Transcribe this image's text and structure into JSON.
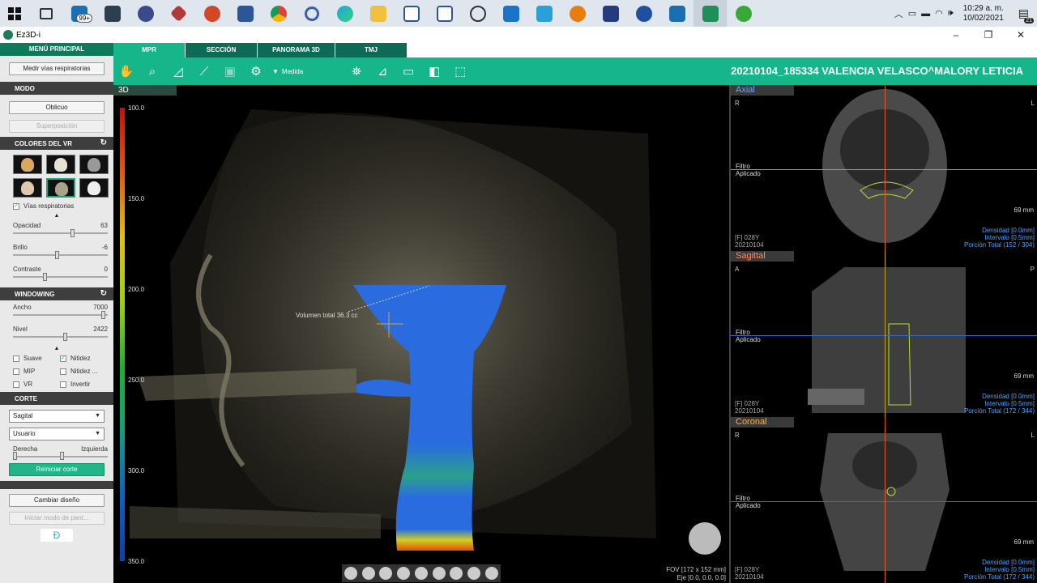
{
  "taskbar": {
    "badge": "99+",
    "time": "10:29 a. m.",
    "date": "10/02/2021",
    "notifications": "21"
  },
  "window": {
    "title": "Ez3D-i"
  },
  "left": {
    "menu_head": "MENÚ PRINCIPAL",
    "airway_button": "Medir vías respiratorias",
    "modo": "MODO",
    "oblicuo": "Oblicuo",
    "superposicion": "Superposición",
    "colores": "COLORES DEL VR",
    "vias_chk": "Vías respiratorias",
    "opacidad_lbl": "Opacidad",
    "opacidad_val": "63",
    "brillo_lbl": "Brillo",
    "brillo_val": "-6",
    "contraste_lbl": "Contraste",
    "contraste_val": "0",
    "windowing": "WINDOWING",
    "ancho_lbl": "Ancho",
    "ancho_val": "7000",
    "nivel_lbl": "Nivel",
    "nivel_val": "2422",
    "suave": "Suave",
    "nitidez": "Nitidez",
    "mip": "MIP",
    "nitidez2": "Nitidez ...",
    "vr": "VR",
    "invertir": "Invertir",
    "corte": "CORTE",
    "sagital": "Sagital",
    "usuario": "Usuario",
    "derecha": "Derecha",
    "izquierda": "Izquierda",
    "reiniciar": "Reiniciar corte",
    "cambiar": "Cambiar diseño",
    "iniciar": "Iniciar modo de pant..."
  },
  "tabs": [
    "MPR",
    "SECCIÓN",
    "PANORAMA 3D",
    "TMJ"
  ],
  "toolbar": {
    "medida": "Medida",
    "patient": "20210104_185334 VALENCIA VELASCO^MALORY LETICIA"
  },
  "view3d": {
    "label": "3D",
    "ticks": [
      "100.0",
      "150.0",
      "200.0",
      "250.0",
      "300.0",
      "350.0"
    ],
    "volume": "Volumen total 36.3 cc",
    "fov": "FOV [172 x 152 mm]",
    "eje": "Eje [0.0, 0.0, 0.0]"
  },
  "axial": {
    "label": "Axial",
    "left": "R",
    "right": "L",
    "filtro": "Filtro",
    "aplicado": "Aplicado",
    "mm": "69 mm",
    "age": "[F] 028Y",
    "date": "20210104",
    "densidad": "Densidad [0.0mm]",
    "intervalo": "Intervalo [0.5mm]",
    "porcion": "Porción Total (152 / 304)"
  },
  "sagittal": {
    "label": "Sagittal",
    "left": "A",
    "right": "P",
    "filtro": "Filtro",
    "aplicado": "Aplicado",
    "mm": "69 mm",
    "age": "[F] 028Y",
    "date": "20210104",
    "densidad": "Densidad [0.0mm]",
    "intervalo": "Intervalo [0.5mm]",
    "porcion": "Porción Total (172 / 344)"
  },
  "coronal": {
    "label": "Coronal",
    "left": "R",
    "right": "L",
    "filtro": "Filtro",
    "aplicado": "Aplicado",
    "mm": "69 mm",
    "age": "[F] 028Y",
    "date": "20210104",
    "densidad": "Densidad [0.0mm]",
    "intervalo": "Intervalo [0.5mm]",
    "porcion": "Porción Total (172 / 344)"
  }
}
